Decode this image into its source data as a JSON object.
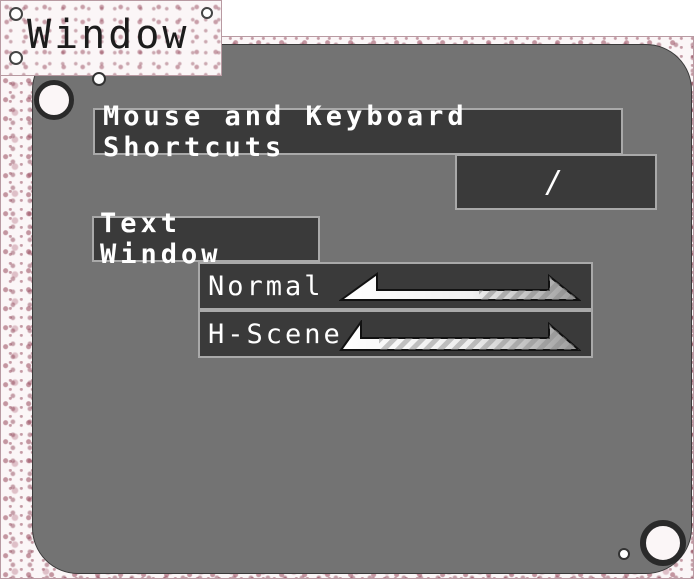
{
  "window_tab": {
    "title": "Window"
  },
  "shortcuts": {
    "heading": "Mouse and Keyboard Shortcuts",
    "value": "/"
  },
  "text_window": {
    "heading": "Text Window",
    "options": [
      {
        "label": "Normal",
        "control": "arrow-slider"
      },
      {
        "label": "H-Scene",
        "control": "arrow-slider"
      }
    ]
  },
  "colors": {
    "panel": "#737373",
    "box": "#3a3a3a",
    "border": "#a9a9a9",
    "frame_accent": "#9b4a5e"
  },
  "icons": [
    "left-arrow-icon"
  ]
}
